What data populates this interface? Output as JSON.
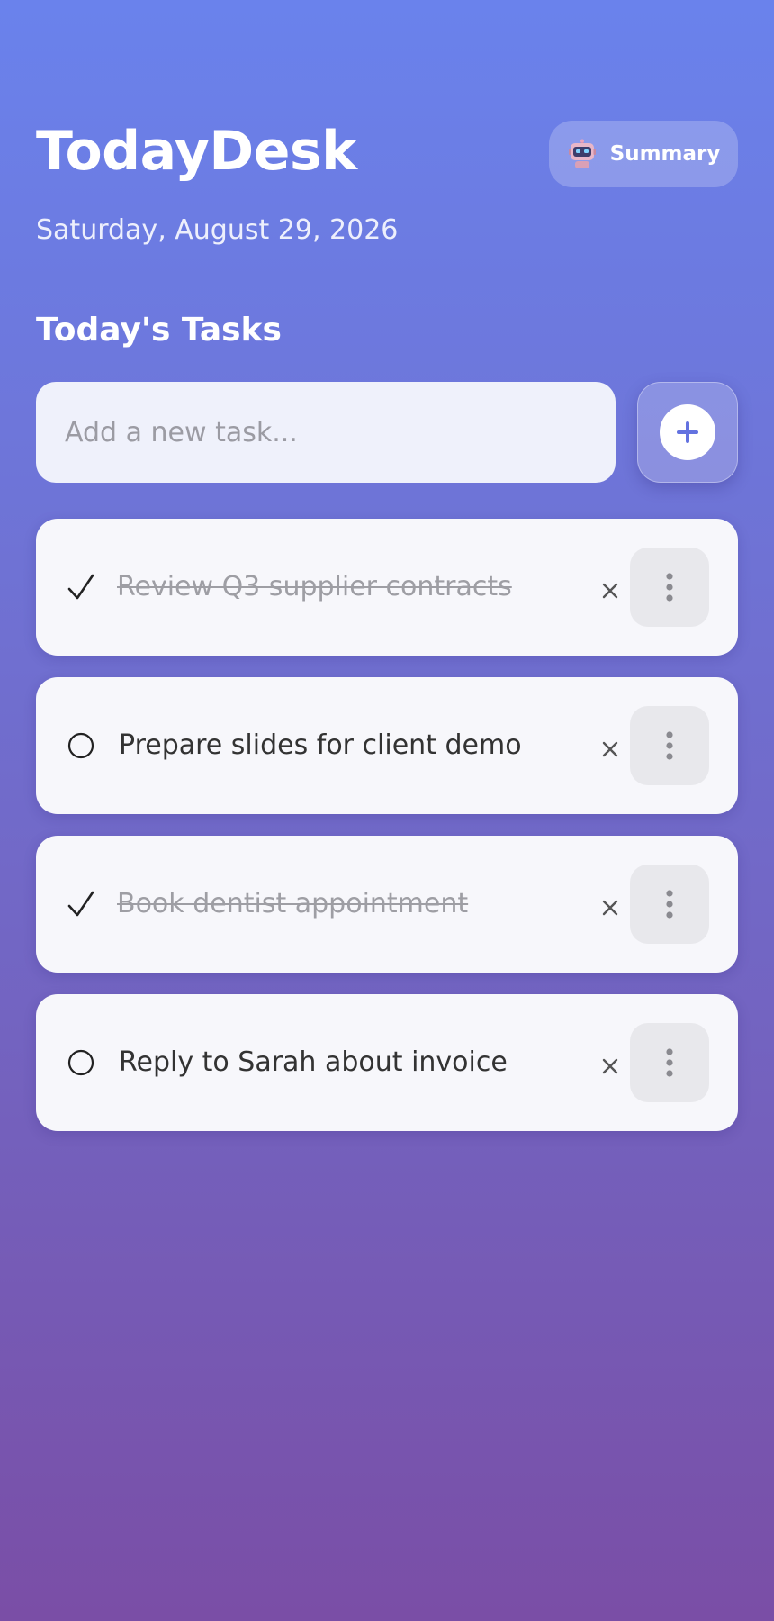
{
  "app": {
    "title": "TodayDesk",
    "date": "Saturday, August 29, 2026",
    "summary_label": "Summary",
    "summary_icon": "robot-icon"
  },
  "tasks_section": {
    "title": "Today's Tasks",
    "input_placeholder": "Add a new task...",
    "input_value": "",
    "add_icon": "plus-icon"
  },
  "tasks": [
    {
      "text": "Review Q3 supplier contracts",
      "done": true
    },
    {
      "text": "Prepare slides for client demo",
      "done": false
    },
    {
      "text": "Book dentist appointment",
      "done": true
    },
    {
      "text": "Reply to Sarah about invoice",
      "done": false
    }
  ],
  "colors": {
    "gradient_top": "#6a82ec",
    "gradient_bottom": "#7a4ea6",
    "accent": "#6372e0",
    "card_bg": "#f7f7fb",
    "done_text": "#9e9ea4"
  }
}
